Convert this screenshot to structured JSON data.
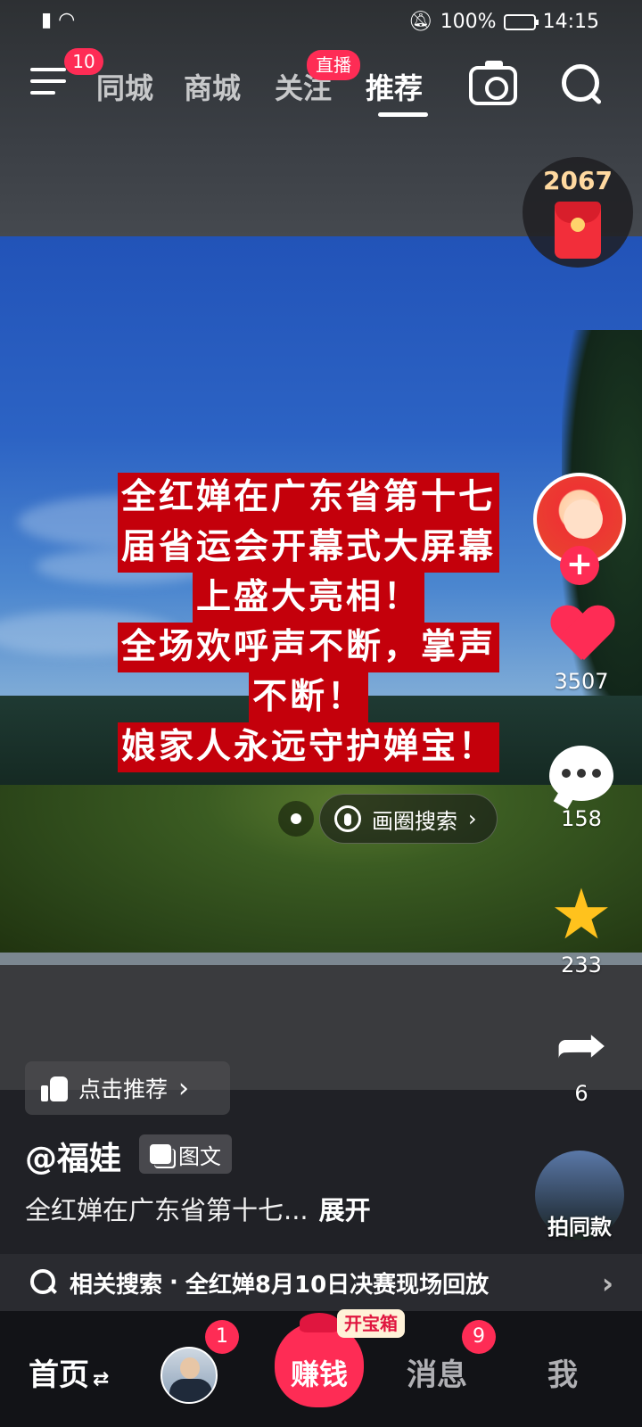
{
  "status_bar": {
    "time": "14:15",
    "battery": "100%"
  },
  "top_nav": {
    "menu_badge": "10",
    "tabs": [
      {
        "label": "同城"
      },
      {
        "label": "商城"
      },
      {
        "label": "关注",
        "badge": "直播"
      },
      {
        "label": "推荐",
        "active": true
      }
    ]
  },
  "red_packet": {
    "count": "2067"
  },
  "caption": {
    "lines": [
      "全红婵在广东省第十七",
      "届省运会开幕式大屏幕",
      "上盛大亮相！",
      "全场欢呼声不断，掌声",
      "不断！",
      "娘家人永远守护婵宝！"
    ]
  },
  "circle_search": {
    "label": "画圈搜索"
  },
  "side_actions": {
    "likes": "3507",
    "comments": "158",
    "favorites": "233",
    "shares": "6",
    "same_style": "拍同款"
  },
  "post": {
    "recommend_label": "点击推荐",
    "author": "@福娃",
    "type_tag": "图文",
    "description": "全红婵在广东省第十七...",
    "expand_label": "展开"
  },
  "related_search": {
    "prefix": "相关搜索",
    "separator": "·",
    "query": "全红婵8月10日决赛现场回放"
  },
  "tab_bar": {
    "home": "首页",
    "home_switch": "⇄",
    "friends_badge": "1",
    "earn": "赚钱",
    "earn_tag": "开宝箱",
    "messages": "消息",
    "messages_badge": "9",
    "me": "我"
  },
  "colors": {
    "accent": "#fe2c55",
    "caption_bg": "#c4000b",
    "star": "#ffc21d"
  },
  "icons": [
    "menu-icon",
    "camera-icon",
    "search-icon",
    "heart-icon",
    "comment-icon",
    "star-icon",
    "share-icon",
    "thumb-up-icon",
    "image-text-icon",
    "magnifier-icon",
    "chevron-right-icon"
  ]
}
